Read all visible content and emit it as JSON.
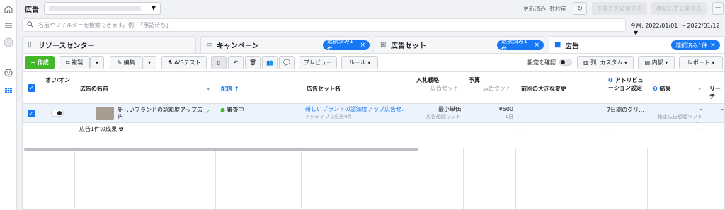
{
  "nav": {
    "icons": [
      "home-icon",
      "menu-icon",
      "account-avatar-icon",
      "emoji-icon",
      "table-icon"
    ]
  },
  "topbar": {
    "title": "広告",
    "updated": "更新済み: 数秒前",
    "discard_label": "下書きを破棄する",
    "publish_label": "確認して公開する",
    "more_label": "···"
  },
  "search": {
    "placeholder": "名前やフィルターを検索できます。例: 「承認待ち」",
    "value": ""
  },
  "date_range": "今月: 2022/01/01 ～ 2022/01/12",
  "tabs": [
    {
      "label": "リソースセンター"
    },
    {
      "label": "キャンペーン",
      "chip": "選択済み1件"
    },
    {
      "label": "広告セット",
      "chip": "選択済み1件"
    },
    {
      "label": "広告",
      "chip": "選択済み1件"
    }
  ],
  "toolbar": {
    "create": "+ 作成",
    "duplicate": "複製",
    "edit": "編集",
    "ab_test": "A/Bテスト",
    "preview": "プレビュー",
    "rules": "ルール",
    "check_settings": "設定を確認",
    "columns": "列: カスタム",
    "breakdown": "内訳",
    "reports": "レポート"
  },
  "columns": {
    "onoff": "オフ/オン",
    "name": "広告の名前",
    "delivery": "配信 ↑",
    "adset_name": "広告セット名",
    "bid_strategy": "入札戦略",
    "bid_strategy_sub": "広告セット",
    "budget": "予算",
    "budget_sub": "広告セット",
    "last_change": "前回の大きな変更",
    "attribution": "アトリビュ\nーション設定",
    "results": "結果",
    "reach": "リーチ"
  },
  "rows": [
    {
      "name": "新しいブランドの認知度アップ広告",
      "delivery": "審査中",
      "adset_name": "新しいブランドの認知度アップ広告セ...",
      "adset_sub": "アクティブな広告0件",
      "bid_strategy": "最小単価",
      "bid_strategy_sub": "広告想起リフト",
      "budget": "¥500",
      "budget_sub": "1日",
      "attribution": "7日間のクリ...",
      "results": "–",
      "results_sub": "推定広告想起リフト(...",
      "reach": "–"
    }
  ],
  "summary": {
    "label": "広告1件の成果",
    "last_change": "–",
    "results": "–",
    "reach": "–"
  },
  "colors": {
    "accent": "#1877f2",
    "create_green": "#42b72a",
    "selected_row": "#edf3fc"
  }
}
